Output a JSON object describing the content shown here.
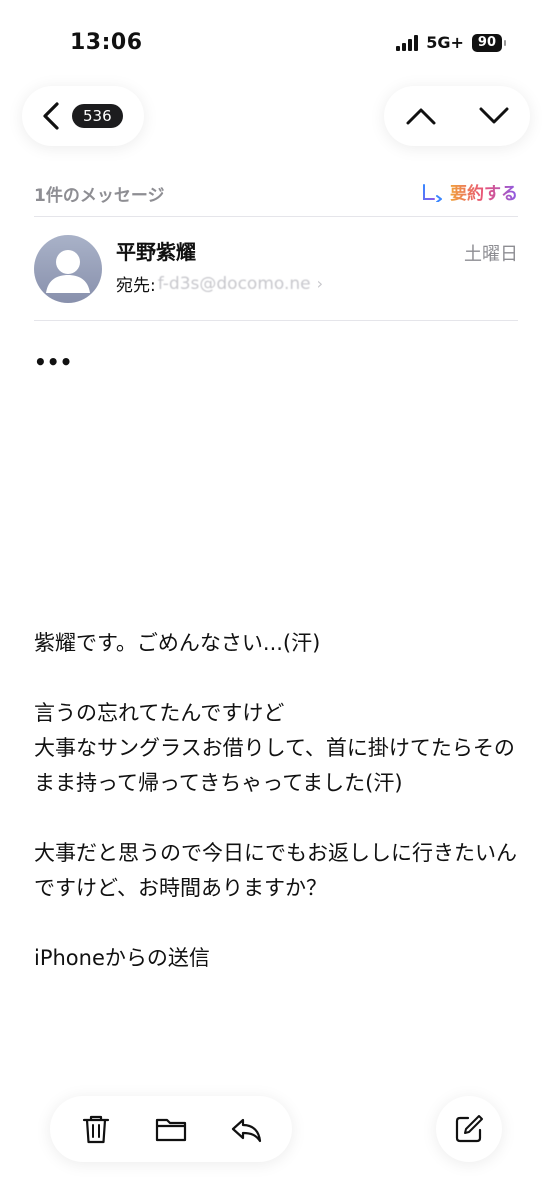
{
  "status_bar": {
    "time": "13:06",
    "network": "5G+",
    "battery": "90"
  },
  "nav": {
    "unread_count": "536",
    "icons": [
      "chevron-left-icon",
      "chevron-up-icon",
      "chevron-down-icon"
    ]
  },
  "header": {
    "message_count": "1件のメッセージ",
    "summarize_label": "要約する"
  },
  "sender": {
    "name": "平野紫耀",
    "date": "土曜日",
    "recipient_prefix": "宛先:",
    "recipient_address": "f-d3s@docomo.ne",
    "recipient_chevron": "›"
  },
  "body": {
    "ellipsis": "•••",
    "paragraphs": [
      "紫耀です。ごめんなさい...(汗)",
      "言うの忘れてたんですけど",
      "大事なサングラスお借りして、首に掛けてたらそのまま持って帰ってきちゃってました(汗)",
      "大事だと思うので今日にでもお返ししに行きたいんですけど、お時間ありますか？",
      "iPhoneからの送信"
    ]
  },
  "toolbar": {
    "icons": [
      "trash-icon",
      "folder-icon",
      "reply-icon",
      "compose-icon"
    ]
  },
  "colors": {
    "badge_bg": "#1c1c1e",
    "secondary_text": "#8e8e93",
    "divider": "#e5e5ea",
    "summarize_gradient": [
      "#f0a23b",
      "#e8527a",
      "#8a5be8"
    ]
  }
}
